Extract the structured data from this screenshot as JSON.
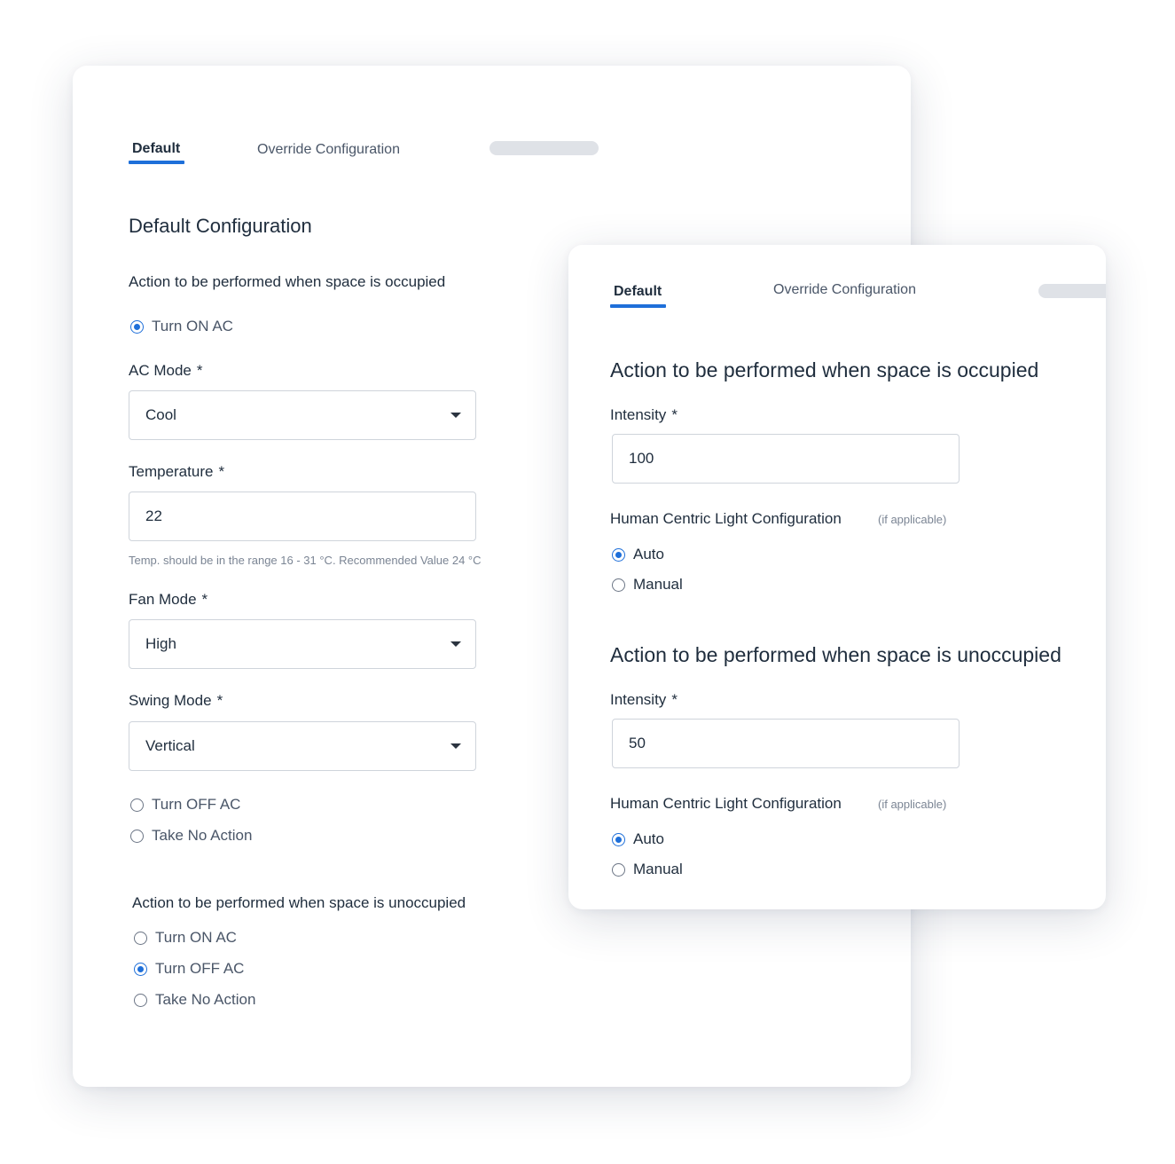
{
  "back_card": {
    "tabs": {
      "default": "Default",
      "override": "Override Configuration"
    },
    "title": "Default Configuration",
    "occupied": {
      "heading": "Action to be performed when space is occupied",
      "turn_on": "Turn ON AC",
      "ac_mode": {
        "label": "AC Mode",
        "required": "*",
        "value": "Cool"
      },
      "temperature": {
        "label": "Temperature",
        "required": "*",
        "value": "22",
        "hint": "Temp. should be in the range 16 - 31 °C. Recommended Value 24 °C"
      },
      "fan_mode": {
        "label": "Fan Mode",
        "required": "*",
        "value": "High"
      },
      "swing_mode": {
        "label": "Swing Mode",
        "required": "*",
        "value": "Vertical"
      },
      "turn_off": "Turn OFF AC",
      "no_action": "Take No Action",
      "selected": "turn_on"
    },
    "unoccupied": {
      "heading": "Action to be performed when space is unoccupied",
      "turn_on": "Turn ON AC",
      "turn_off": "Turn OFF AC",
      "no_action": "Take No Action",
      "selected": "turn_off"
    }
  },
  "front_card": {
    "tabs": {
      "default": "Default",
      "override": "Override Configuration"
    },
    "occupied": {
      "heading": "Action to be performed when space is occupied",
      "intensity": {
        "label": "Intensity",
        "required": "*",
        "value": "100"
      },
      "hcl": {
        "label": "Human Centric Light Configuration",
        "note": "(if applicable)"
      },
      "auto": "Auto",
      "manual": "Manual",
      "selected": "auto"
    },
    "unoccupied": {
      "heading": "Action to be performed when space is unoccupied",
      "intensity": {
        "label": "Intensity",
        "required": "*",
        "value": "50"
      },
      "hcl": {
        "label": "Human Centric Light Configuration",
        "note": "(if applicable)"
      },
      "auto": "Auto",
      "manual": "Manual",
      "selected": "auto"
    }
  },
  "colors": {
    "accent": "#1e6fd9",
    "text": "#1f2d3d",
    "muted": "#7b8594",
    "border": "#cfd4db"
  }
}
